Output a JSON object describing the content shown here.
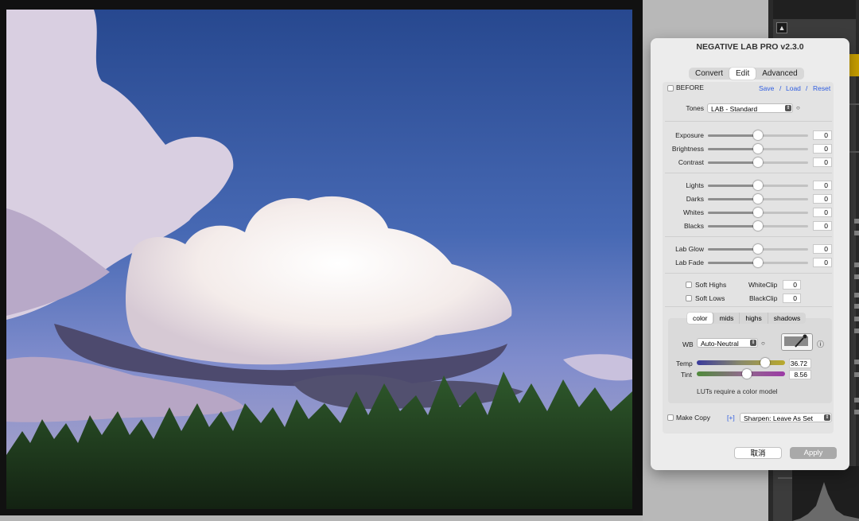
{
  "dialog": {
    "title": "NEGATIVE LAB PRO v2.3.0",
    "tabs": [
      "Convert",
      "Edit",
      "Advanced"
    ],
    "active_tab": "Edit",
    "before_label": "BEFORE",
    "save": "Save",
    "load": "Load",
    "reset": "Reset",
    "slash": "/",
    "tones_label": "Tones",
    "tones_value": "LAB - Standard",
    "sliders_group1": [
      {
        "label": "Exposure",
        "value": "0"
      },
      {
        "label": "Brightness",
        "value": "0"
      },
      {
        "label": "Contrast",
        "value": "0"
      }
    ],
    "sliders_group2": [
      {
        "label": "Lights",
        "value": "0"
      },
      {
        "label": "Darks",
        "value": "0"
      },
      {
        "label": "Whites",
        "value": "0"
      },
      {
        "label": "Blacks",
        "value": "0"
      }
    ],
    "sliders_group3": [
      {
        "label": "Lab Glow",
        "value": "0"
      },
      {
        "label": "Lab Fade",
        "value": "0"
      }
    ],
    "soft_highs": "Soft Highs",
    "soft_lows": "Soft Lows",
    "whiteclip_label": "WhiteClip",
    "whiteclip_value": "0",
    "blackclip_label": "BlackClip",
    "blackclip_value": "0",
    "color_tabs": [
      "color",
      "mids",
      "highs",
      "shadows"
    ],
    "active_color_tab": "color",
    "wb_label": "WB",
    "wb_value": "Auto-Neutral",
    "temp_label": "Temp",
    "temp_value": "36.72",
    "tint_label": "Tint",
    "tint_value": "8.56",
    "luts_note": "LUTs require a color model",
    "make_copy": "Make Copy",
    "plus": "[+]",
    "sharpen_value": "Sharpen: Leave As Set",
    "cancel": "取消",
    "apply": "Apply"
  },
  "icons": {
    "circle_dot": "○",
    "info": "ⓘ",
    "up_triangle": "▲"
  },
  "colors": {
    "link": "#2f5de0",
    "apply_button": "#a9a9a9",
    "sky_top": "#2d4f9a",
    "sky_bottom": "#8f9bcf"
  }
}
